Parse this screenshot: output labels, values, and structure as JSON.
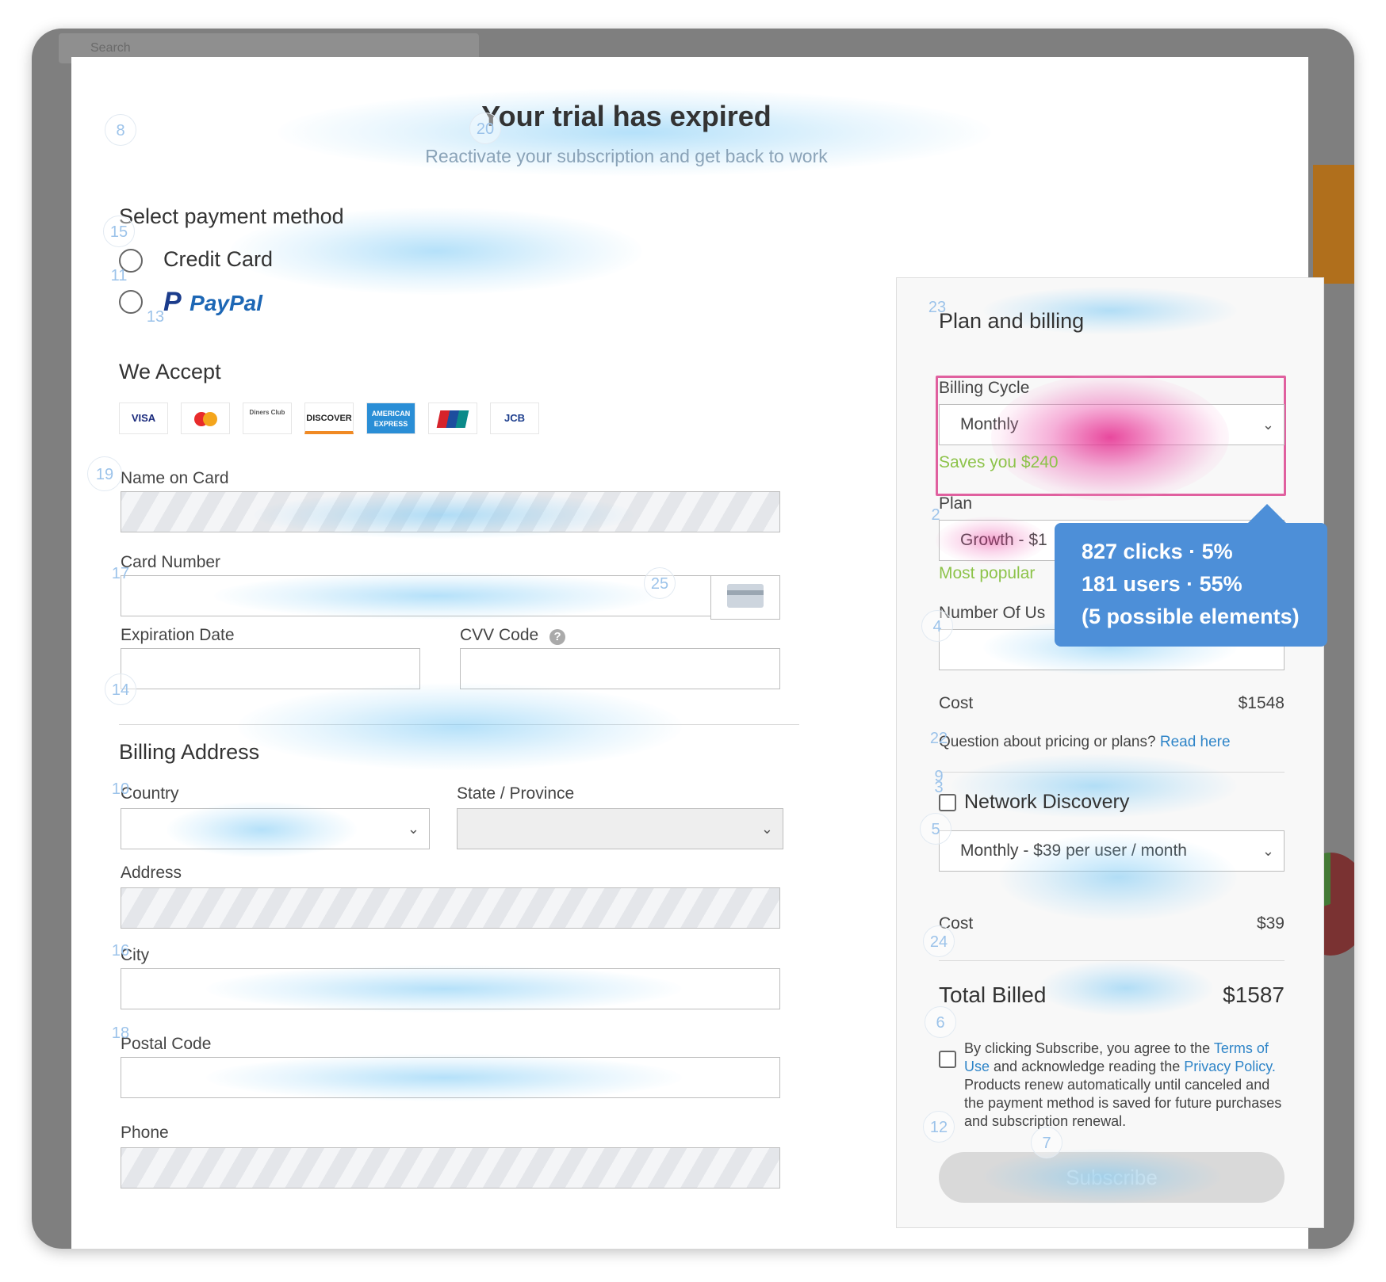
{
  "background": {
    "search_placeholder": "Search"
  },
  "header": {
    "title": "Your trial has expired",
    "subtitle": "Reactivate your subscription and get back to work"
  },
  "payment": {
    "section_title": "Select payment method",
    "credit_card_label": "Credit Card",
    "paypal_label": "PayPal",
    "we_accept_title": "We Accept",
    "cards": [
      "VISA",
      "MC",
      "Diners Club",
      "DISCOVER",
      "AMERICAN EXPRESS",
      "UnionPay",
      "JCB"
    ],
    "name_label": "Name on Card",
    "card_number_label": "Card Number",
    "expiration_label": "Expiration Date",
    "cvv_label": "CVV Code",
    "cvv_help": "?"
  },
  "billing_address": {
    "title": "Billing Address",
    "country_label": "Country",
    "state_label": "State / Province",
    "address_label": "Address",
    "city_label": "City",
    "postal_label": "Postal Code",
    "phone_label": "Phone"
  },
  "plan": {
    "title": "Plan and billing",
    "billing_cycle_label": "Billing Cycle",
    "billing_cycle_value": "Monthly",
    "billing_cycle_note": "Saves you $240",
    "plan_label": "Plan",
    "plan_value": "Growth - $1",
    "plan_note": "Most popular",
    "users_label": "Number Of Us",
    "cost_label": "Cost",
    "cost_value": "$1548",
    "question_text": "Question about pricing or plans?",
    "read_here": "Read here",
    "network_label": "Network Discovery",
    "network_value": "Monthly - $39 per user / month",
    "network_cost_label": "Cost",
    "network_cost_value": "$39",
    "total_label": "Total Billed",
    "total_value": "$1587",
    "terms_1": "By clicking Subscribe, you agree to the",
    "terms_link1": "Terms of Use",
    "terms_2": "and acknowledge reading the",
    "terms_link2": "Privacy Policy.",
    "terms_3": "Products renew automatically until canceled and the payment method is saved for future purchases and subscription renewal.",
    "subscribe_label": "Subscribe"
  },
  "tooltip": {
    "line1": "827 clicks · 5%",
    "line2": "181 users · 55%",
    "line3": "(5 possible elements)"
  },
  "markers": [
    "8",
    "20",
    "15",
    "11",
    "13",
    "19",
    "17",
    "25",
    "14",
    "10",
    "16",
    "18",
    "23",
    "2",
    "4",
    "22",
    "9",
    "3",
    "5",
    "24",
    "6",
    "12",
    "7"
  ],
  "colors": {
    "accent": "#2f85c8",
    "tooltip": "#4d8fd8",
    "highlight": "#e0609f",
    "note_green": "#8dc34a"
  }
}
